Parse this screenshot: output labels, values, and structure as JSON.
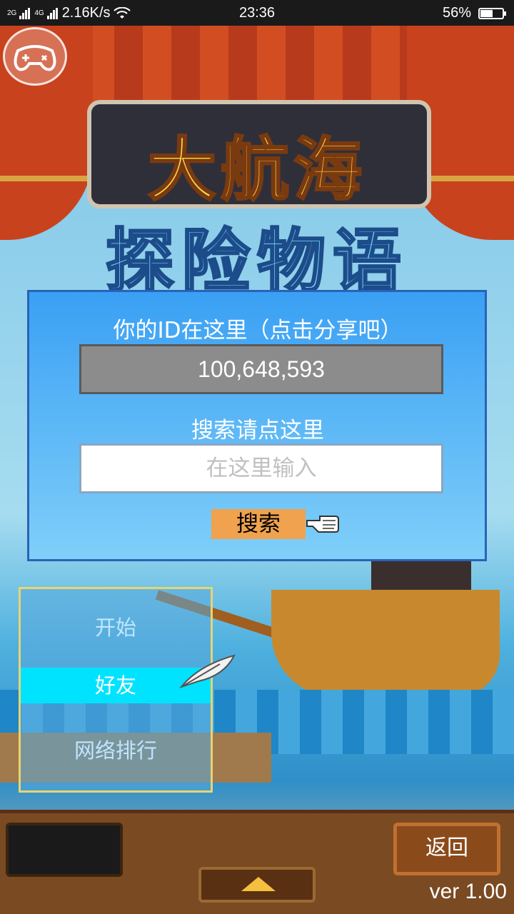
{
  "status_bar": {
    "network_left": "2G",
    "network_right": "4G",
    "speed": "2.16K/s",
    "time": "23:36",
    "battery": "56%",
    "battery_level": 0.56
  },
  "game": {
    "title_line1": "大航海",
    "title_line2": "探险物语"
  },
  "share_dialog": {
    "id_title": "你的ID在这里（点击分享吧）",
    "id_value": "100,648,593",
    "search_title": "搜索请点这里",
    "search_placeholder": "在这里输入",
    "search_button": "搜索"
  },
  "menu": {
    "items": [
      {
        "label": "开始",
        "active": false
      },
      {
        "label": "好友",
        "active": true
      },
      {
        "label": "网络排行",
        "active": false
      }
    ]
  },
  "footer": {
    "back_label": "返回",
    "version": "ver 1.00"
  },
  "icons": {
    "gamepad": "gamepad-icon",
    "pointing_hand": "pointing-hand-icon",
    "feather": "quill-feather-icon",
    "up_arrow": "triangle-up-icon"
  },
  "colors": {
    "dialog_blue": "#3aa0f4",
    "highlight_cyan": "#00e3ff",
    "search_button": "#f0a24e"
  }
}
